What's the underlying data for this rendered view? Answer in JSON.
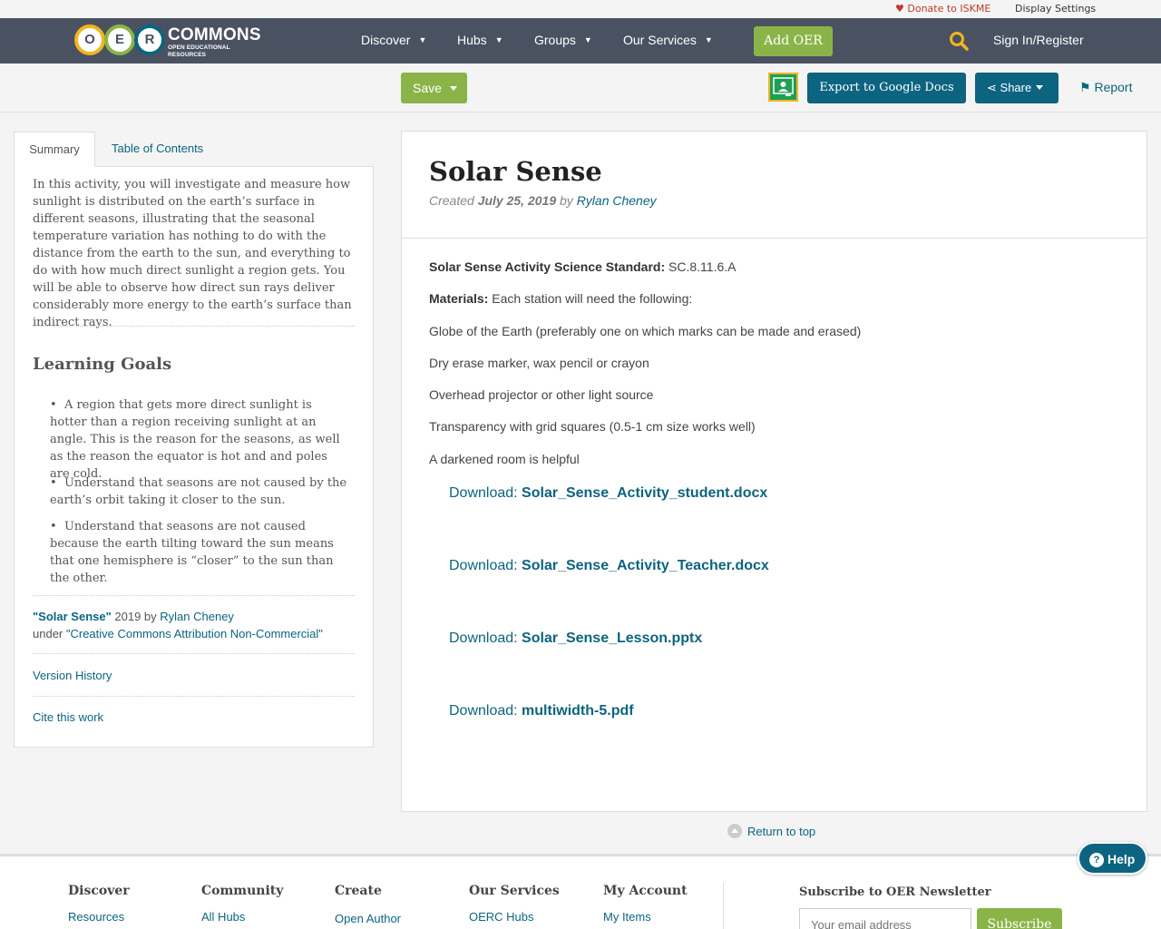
{
  "utility": {
    "donate_label": "Donate to ISKME",
    "display_settings_label": "Display Settings"
  },
  "nav": {
    "logo_letters": [
      "O",
      "E",
      "R"
    ],
    "logo_title": "COMMONS",
    "logo_subtitle": "OPEN EDUCATIONAL RESOURCES",
    "items": [
      {
        "label": "Discover"
      },
      {
        "label": "Hubs"
      },
      {
        "label": "Groups"
      },
      {
        "label": "Our Services"
      }
    ],
    "add_oer_label": "Add OER",
    "signin_label": "Sign In/Register",
    "icons": {
      "search": "search-icon",
      "chevron": "chevron-down-icon",
      "heart": "heart-icon"
    }
  },
  "toolbar": {
    "save_label": "Save",
    "export_label": "Export to Google Docs",
    "share_label": "Share",
    "report_label": "Report"
  },
  "sidebar": {
    "tabs": [
      {
        "label": "Summary"
      },
      {
        "label": "Table of Contents"
      }
    ],
    "summary": "In this activity, you will investigate and measure how sunlight is distributed on the earth’s surface in different seasons, illustrating that the seasonal temperature variation has nothing to do with the distance from the earth to the sun, and everything to do with how much direct sunlight a region gets. You will be able to observe how direct sun rays deliver considerably more energy to the earth’s surface than indirect rays.",
    "learning_goals_heading": "Learning Goals",
    "learning_goals": [
      "A region that gets more direct sunlight is hotter than a region receiving sunlight at an angle. This is the reason for the seasons, as well as the reason the equator is hot and and poles are cold.",
      "Understand that seasons are not caused by the earth’s orbit taking it closer to the sun.",
      "Understand that seasons are not caused because the earth tilting toward the sun means that one hemisphere is “closer” to the sun than the other."
    ],
    "attribution": {
      "work_title": "\"Solar Sense\"",
      "year_by": " 2019 by ",
      "author": "Rylan Cheney",
      "under": "under ",
      "license": "\"Creative Commons Attribution Non-Commercial\""
    },
    "version_history_label": "Version History",
    "cite_label": "Cite this work"
  },
  "content": {
    "title": "Solar Sense",
    "created_prefix": "Created ",
    "created_date": "July 25, 2019",
    "by": " by ",
    "author": "Rylan Cheney",
    "standard_label": "Solar Sense Activity  Science Standard:",
    "standard_value": " SC.8.11.6.A",
    "materials_label": "Materials:",
    "materials_text": "  Each station will need the following:",
    "items": [
      "Globe of the Earth  (preferably one on which marks can be made and erased)",
      "Dry erase marker, wax pencil or crayon",
      "Overhead projector or other light source",
      "Transparency with grid squares (0.5-1 cm size works well)",
      "A darkened room is helpful"
    ],
    "download_prefix": "Download: ",
    "downloads": [
      "Solar_Sense_Activity_student.docx",
      "Solar_Sense_Activity_Teacher.docx",
      "Solar_Sense_Lesson.pptx",
      "multiwidth-5.pdf"
    ]
  },
  "return_top_label": "Return to top",
  "footer": {
    "columns": [
      {
        "title": "Discover",
        "link": "Resources"
      },
      {
        "title": "Community",
        "link": "All Hubs"
      },
      {
        "title": "Create",
        "link": "Open Author"
      },
      {
        "title": "Our Services",
        "link": "OERC Hubs"
      },
      {
        "title": "My Account",
        "link": "My Items"
      }
    ],
    "newsletter_title": "Subscribe to OER Newsletter",
    "email_placeholder": "Your email address",
    "subscribe_label": "Subscribe"
  },
  "help_label": "Help",
  "colors": {
    "nav_bg": "#4a5262",
    "green": "#8ab448",
    "teal": "#0c6480",
    "donate_red": "#c0392b",
    "logo_o": "#f2b51f",
    "logo_e": "#8ab448",
    "logo_r": "#0c6480"
  }
}
